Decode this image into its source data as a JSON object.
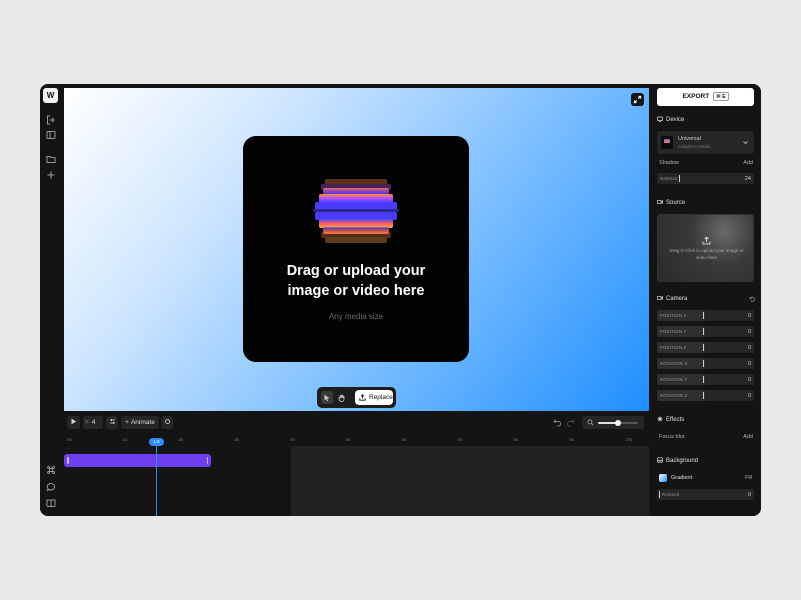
{
  "app": {
    "logo": "W"
  },
  "rail": {
    "icons": [
      "logout-icon",
      "sidebar-icon",
      "folder-icon",
      "plus-icon",
      "command-icon",
      "chat-icon",
      "book-icon"
    ]
  },
  "canvas": {
    "gradient_colors": [
      "#ffffff",
      "#1f8fff"
    ],
    "drop_title_line1": "Drag or upload your",
    "drop_title_line2": "image or video here",
    "drop_subtitle": "Any media size",
    "toolbar": {
      "replace_label": "Replace"
    }
  },
  "timeline": {
    "step_value": "4",
    "animate_label": "Animate",
    "zoom_level": 0.5,
    "ticks": [
      "0s",
      "1s",
      "2s",
      "3s",
      "4s",
      "5s",
      "6s",
      "7s",
      "8s",
      "9s",
      "10s"
    ],
    "playhead_label": "1.6",
    "clip_color": "#6d3ff0",
    "accent": "#2f8cff"
  },
  "panel": {
    "export_label": "EXPORT",
    "export_shortcut": "⌘ E",
    "device": {
      "title": "Device",
      "name": "Universal",
      "subtitle": "Adapts to media",
      "shadow_label": "Shadow",
      "shadow_action": "Add",
      "radius_label": "RADIUS",
      "radius_value": "24"
    },
    "source": {
      "title": "Source",
      "hint": "Drag in Click to upload your image or video here"
    },
    "camera": {
      "title": "Camera",
      "fields": [
        {
          "label": "POSITION X",
          "value": "0"
        },
        {
          "label": "POSITION Y",
          "value": "0"
        },
        {
          "label": "POSITION Z",
          "value": "0"
        },
        {
          "label": "ROTATION X",
          "value": "0"
        },
        {
          "label": "ROTATION Y",
          "value": "0"
        },
        {
          "label": "ROTATION Z",
          "value": "0"
        }
      ]
    },
    "effects": {
      "title": "Effects",
      "focus_label": "Focus blur",
      "focus_action": "Add"
    },
    "background": {
      "title": "Background",
      "gradient_label": "Gradient",
      "gradient_action": "Fill",
      "radius_label": "RADIUS",
      "radius_value": "0"
    }
  }
}
